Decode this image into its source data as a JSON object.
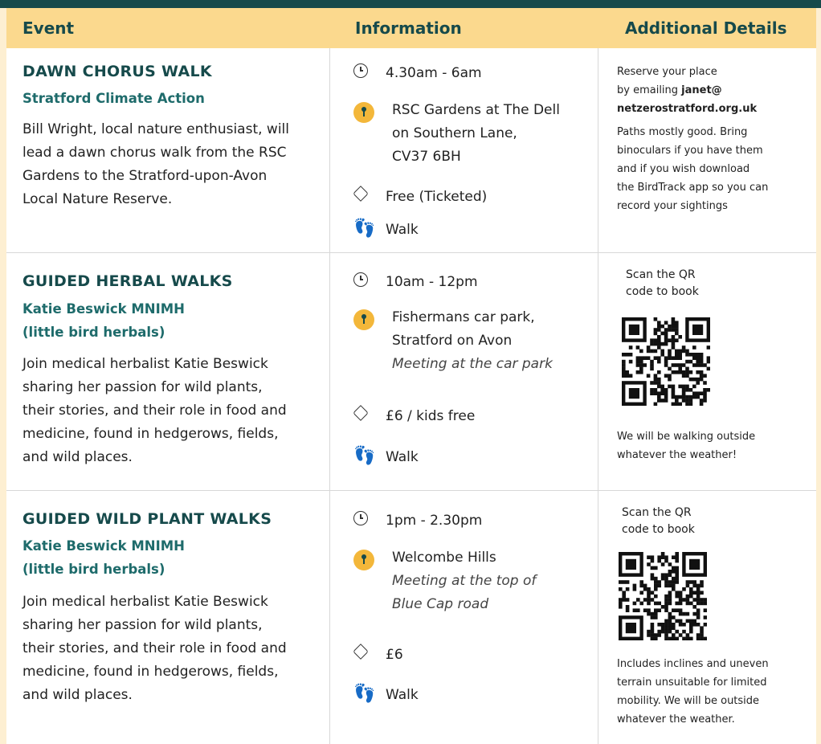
{
  "header": {
    "event": "Event",
    "information": "Information",
    "additional": "Additional Details"
  },
  "events": [
    {
      "title": "DAWN CHORUS WALK",
      "org": [
        "Stratford Climate Action"
      ],
      "desc": [
        "Bill Wright, local nature enthusiast, will",
        "lead a dawn chorus walk from the RSC",
        "Gardens to the Stratford-upon-Avon",
        "Local Nature Reserve."
      ],
      "time": "4.30am - 6am",
      "location": [
        "RSC Gardens at The Dell",
        "on Southern Lane,",
        "CV37 6BH"
      ],
      "location_note": [],
      "price": "Free (Ticketed)",
      "mode": "Walk",
      "details": {
        "line1": "Reserve your place",
        "line2_prefix": "by emailing ",
        "email_a": "janet@",
        "email_b": "netzerostratford.org.uk",
        "notes": [
          "Paths mostly good. Bring",
          "binoculars if you have them",
          "and if you wish download",
          "the BirdTrack app so you can",
          "record your sightings"
        ]
      }
    },
    {
      "title": "GUIDED HERBAL WALKS",
      "org": [
        "Katie Beswick MNIMH",
        "(little bird herbals)"
      ],
      "desc": [
        "Join medical herbalist Katie Beswick",
        "sharing her passion for wild plants,",
        "their stories, and their role in food and",
        "medicine, found in hedgerows, fields,",
        "and wild places."
      ],
      "time": "10am - 12pm",
      "location": [
        "Fishermans car park,",
        "Stratford on Avon"
      ],
      "location_note": [
        "Meeting at the car park"
      ],
      "price": "£6 / kids free",
      "mode": "Walk",
      "details": {
        "qr_label": [
          "Scan the QR",
          "code to book"
        ],
        "notes": [
          "We will be walking outside",
          "whatever the weather!"
        ]
      }
    },
    {
      "title": "GUIDED WILD PLANT WALKS",
      "org": [
        "Katie Beswick MNIMH",
        "(little bird herbals)"
      ],
      "desc": [
        "Join medical herbalist Katie Beswick",
        "sharing her passion for wild plants,",
        "their stories, and their role in food and",
        "medicine, found in hedgerows, fields,",
        "and wild places."
      ],
      "time": "1pm - 2.30pm",
      "location": [
        "Welcombe Hills"
      ],
      "location_note": [
        "Meeting at the top of",
        "Blue Cap road"
      ],
      "price": "£6",
      "mode": "Walk",
      "details": {
        "qr_label": [
          "Scan the QR",
          "code to book"
        ],
        "notes": [
          "Includes inclines and uneven",
          "terrain unsuitable for limited",
          "mobility. We will be outside",
          "whatever the weather."
        ]
      }
    }
  ],
  "icons": {
    "time": "clock-icon",
    "location": "map-pin-icon",
    "price": "ticket-tag-icon",
    "mode": "footprint-icon"
  },
  "colors": {
    "teal": "#164a4b",
    "header_bg": "#fbd98e",
    "page_bg": "#fdefd2",
    "pin": "#f3b73a"
  }
}
